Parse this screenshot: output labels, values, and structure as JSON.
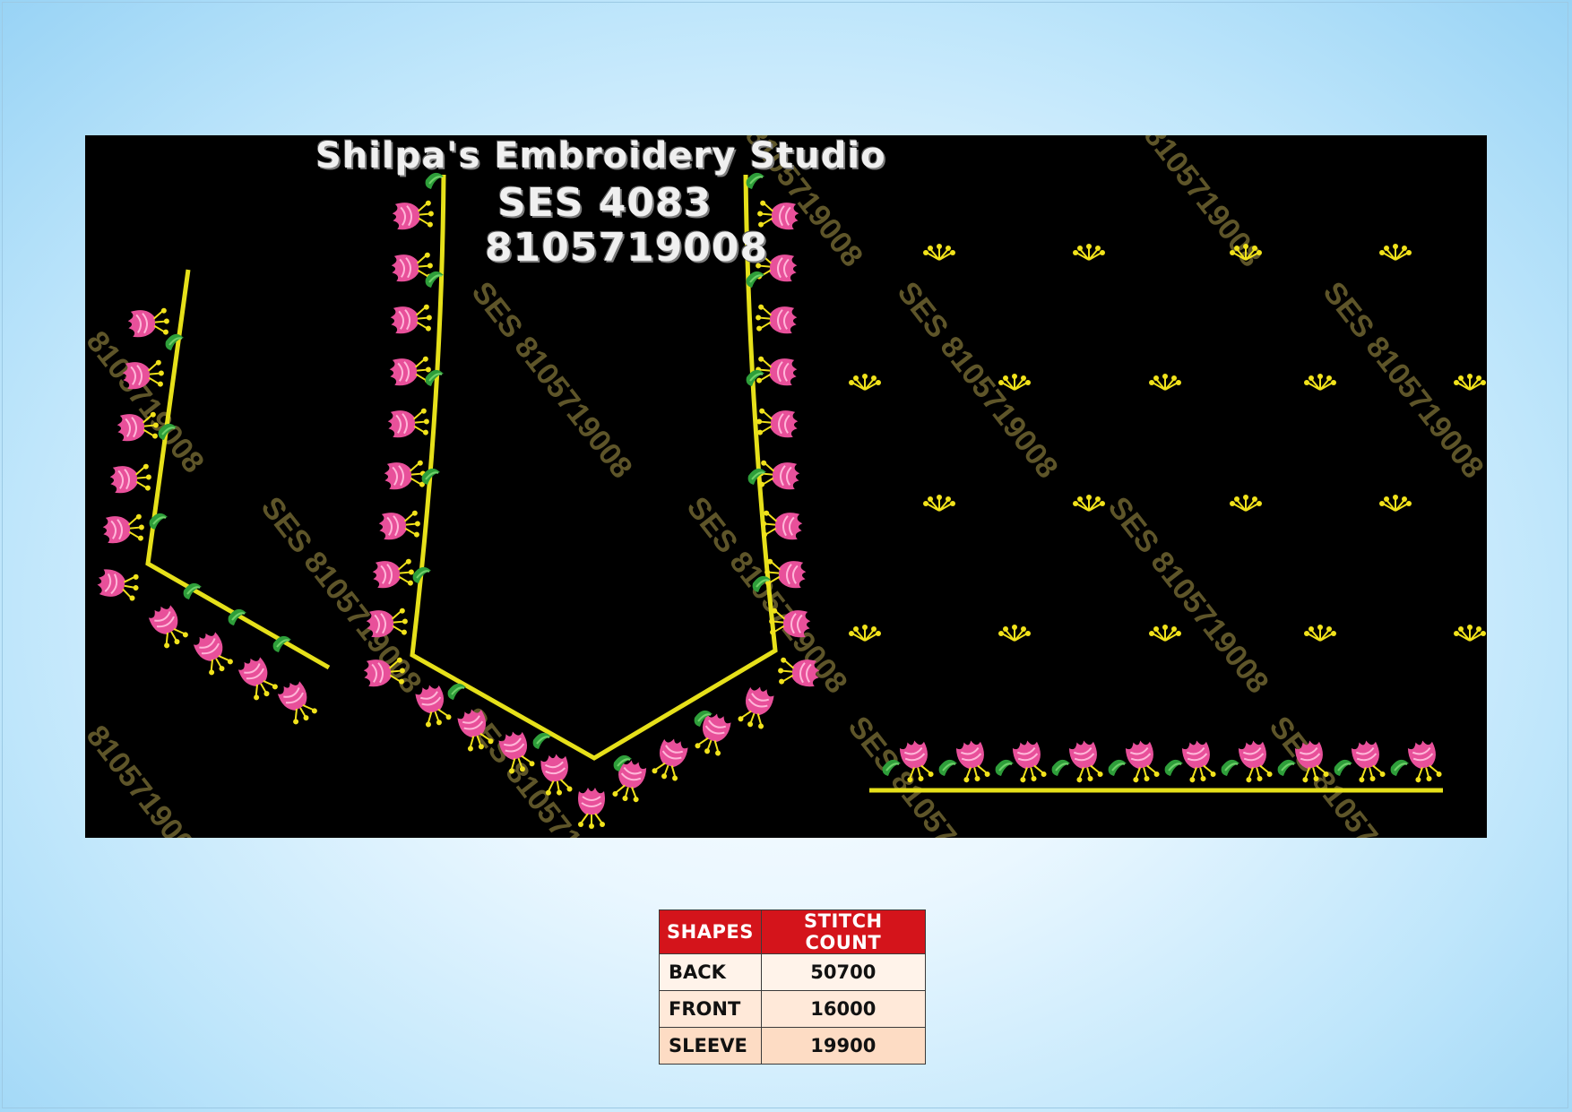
{
  "header": {
    "studio_name": "Shilpa's Embroidery Studio",
    "design_code": "SES 4083",
    "phone": "8105719008"
  },
  "watermark": {
    "text": "SES 8105719008",
    "partial_text": "8105719008"
  },
  "colors": {
    "background": "#000000",
    "outline": "#e6e01a",
    "flower": "#e8509a",
    "leaf": "#2e9e3a",
    "stamen": "#f1e21b",
    "table_header": "#d4141b"
  },
  "stitch_table": {
    "headers": [
      "SHAPES",
      "STITCH COUNT"
    ],
    "rows": [
      {
        "shape": "BACK",
        "count": "50700"
      },
      {
        "shape": "FRONT",
        "count": "16000"
      },
      {
        "shape": "SLEEVE",
        "count": "19900"
      }
    ]
  }
}
